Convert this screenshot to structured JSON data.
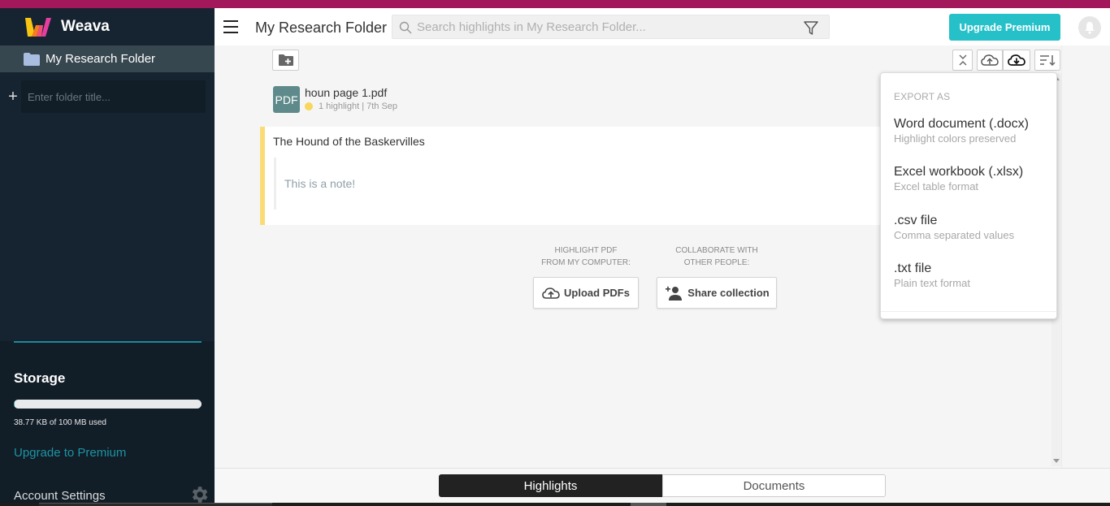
{
  "app": {
    "name": "Weava",
    "brand_colors": {
      "logo_yellow": "#f9c513",
      "logo_pink": "#e63ea0",
      "accent_teal": "#26c0c9",
      "top_strip": "#a3185a"
    }
  },
  "sidebar": {
    "folders": [
      {
        "label": "My Research Folder",
        "icon": "folder-icon",
        "selected": true
      }
    ],
    "new_folder": {
      "placeholder": "Enter folder title...",
      "value": ""
    },
    "storage": {
      "title": "Storage",
      "used_text": "38.77 KB of 100 MB used",
      "used_fraction": 0.0004
    },
    "upgrade_link": "Upgrade to Premium",
    "account_settings": "Account Settings"
  },
  "header": {
    "menu_icon": "hamburger-icon",
    "title": "My Research Folder",
    "search": {
      "placeholder": "Search highlights in My Research Folder...",
      "value": ""
    },
    "filter_icon": "filter-icon",
    "upgrade_button": "Upgrade Premium",
    "notification_icon": "bell-icon"
  },
  "toolbar": {
    "new_folder_icon": "folder-plus-icon",
    "collapse_icon": "collapse-icon",
    "upload_icon": "cloud-upload-icon",
    "download_icon": "cloud-download-icon",
    "sort_icon": "sort-icon"
  },
  "document": {
    "badge": "PDF",
    "name": "houn page 1.pdf",
    "meta": "1 highlight | 7th Sep",
    "highlight_color": "#f9d65c"
  },
  "highlight": {
    "text": "The Hound of the Baskervilles",
    "note": "This is a note!"
  },
  "cta": {
    "upload": {
      "label": "HIGHLIGHT PDF FROM MY COMPUTER:",
      "label_line1": "HIGHLIGHT PDF",
      "label_line2": "FROM MY COMPUTER:",
      "button": "Upload PDFs"
    },
    "share": {
      "label_line1": "COLLABORATE WITH",
      "label_line2": "OTHER PEOPLE:",
      "button": "Share collection"
    }
  },
  "export_menu": {
    "heading": "EXPORT AS",
    "items": [
      {
        "title": "Word document (.docx)",
        "subtitle": "Highlight colors preserved"
      },
      {
        "title": "Excel workbook (.xlsx)",
        "subtitle": "Excel table format"
      },
      {
        "title": ".csv file",
        "subtitle": "Comma separated values"
      },
      {
        "title": ".txt file",
        "subtitle": "Plain text format"
      }
    ]
  },
  "bottom_tabs": [
    {
      "label": "Highlights",
      "active": true
    },
    {
      "label": "Documents",
      "active": false
    }
  ]
}
